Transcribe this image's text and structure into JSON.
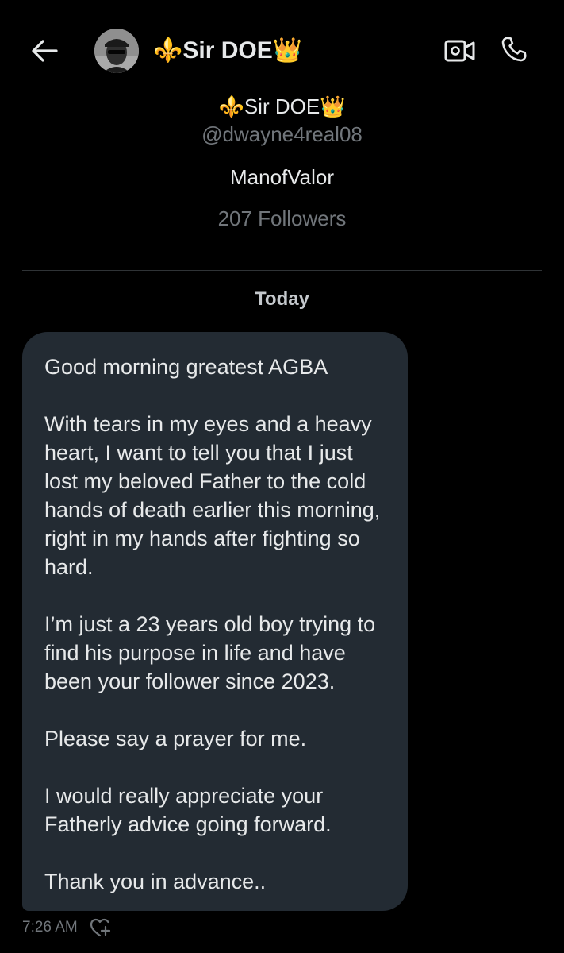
{
  "header": {
    "name": "⚜️Sir DOE👑",
    "back_icon": "arrow-left-icon",
    "video_icon": "video-camera-icon",
    "call_icon": "phone-icon"
  },
  "profile": {
    "name": "⚜️Sir DOE👑",
    "handle": "@dwayne4real08",
    "bio": "ManofValor",
    "followers": "207 Followers"
  },
  "conversation": {
    "date_label": "Today",
    "message": {
      "paragraphs": [
        "Good morning greatest AGBA",
        "With tears in my eyes and a heavy heart, I want to tell you that I just lost my beloved Father to the cold hands of death earlier this morning, right in my hands after fighting so hard.",
        "I’m just a 23 years old boy trying to find his purpose in life and have been your follower since 2023.",
        "Please say a prayer for me.",
        "I would really appreciate your Fatherly advice going forward.",
        "Thank you in advance.."
      ],
      "time": "7:26 AM",
      "react_icon": "heart-plus-icon"
    }
  },
  "colors": {
    "background": "#000000",
    "bubble": "#232b33",
    "primary_text": "#e7e9ea",
    "secondary_text": "#71767b",
    "divider": "#2f3336"
  }
}
